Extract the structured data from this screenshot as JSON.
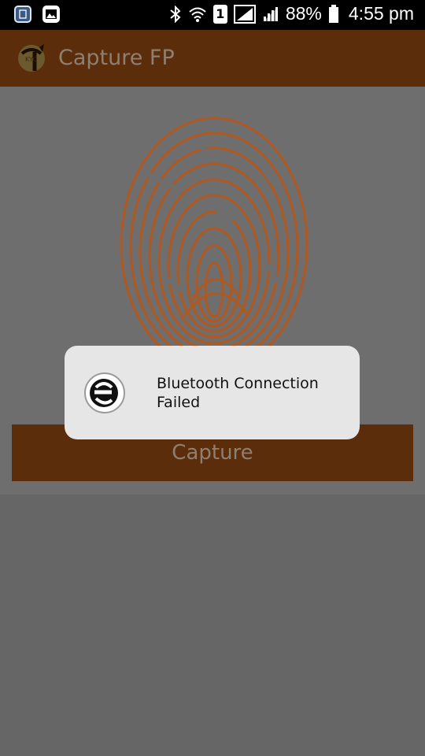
{
  "status_bar": {
    "battery": "88%",
    "time": "4:55 pm",
    "sim_slot": "1"
  },
  "app_bar": {
    "title": "Capture FP",
    "logo_text": "KYC"
  },
  "main": {
    "capture_button_label": "Capture"
  },
  "toast": {
    "message": "Bluetooth Connection Failed"
  },
  "colors": {
    "app_bar": "#5b2d0b",
    "fingerprint": "#b4571c",
    "toast_bg": "#e6e6e6"
  }
}
